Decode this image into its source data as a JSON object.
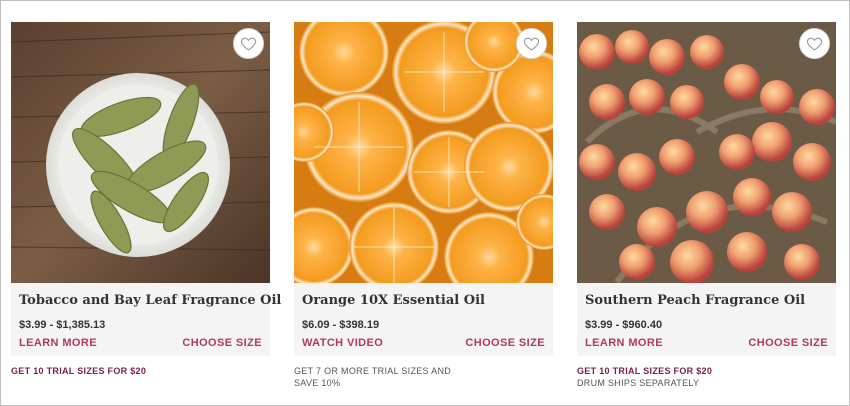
{
  "products": [
    {
      "title": "Tobacco and Bay Leaf Fragrance Oil",
      "price": "$3.99 - $1,385.13",
      "primary_link": "LEARN MORE",
      "secondary_link": "CHOOSE SIZE",
      "promo": "GET 10 TRIAL SIZES FOR $20",
      "promo_note": "",
      "image_alt": "Bay leaves in a white bowl on wood",
      "icon": "heart-icon"
    },
    {
      "title": "Orange 10X Essential Oil",
      "price": "$6.09 - $398.19",
      "primary_link": "WATCH VIDEO",
      "secondary_link": "CHOOSE SIZE",
      "promo": "GET 7 OR MORE TRIAL SIZES AND",
      "promo_note": "SAVE 10%",
      "image_alt": "Halved oranges",
      "icon": "heart-icon"
    },
    {
      "title": "Southern Peach Fragrance Oil",
      "price": "$3.99 - $960.40",
      "primary_link": "LEARN MORE",
      "secondary_link": "CHOOSE SIZE",
      "promo": "GET 10 TRIAL SIZES FOR $20",
      "promo_note": "DRUM SHIPS SEPARATELY",
      "image_alt": "Peaches in wooden baskets",
      "icon": "heart-icon"
    }
  ],
  "colors": {
    "accent_link": "#b03a5b",
    "promo_accent": "#7a1e4e",
    "card_bg": "#f4f4f4"
  }
}
